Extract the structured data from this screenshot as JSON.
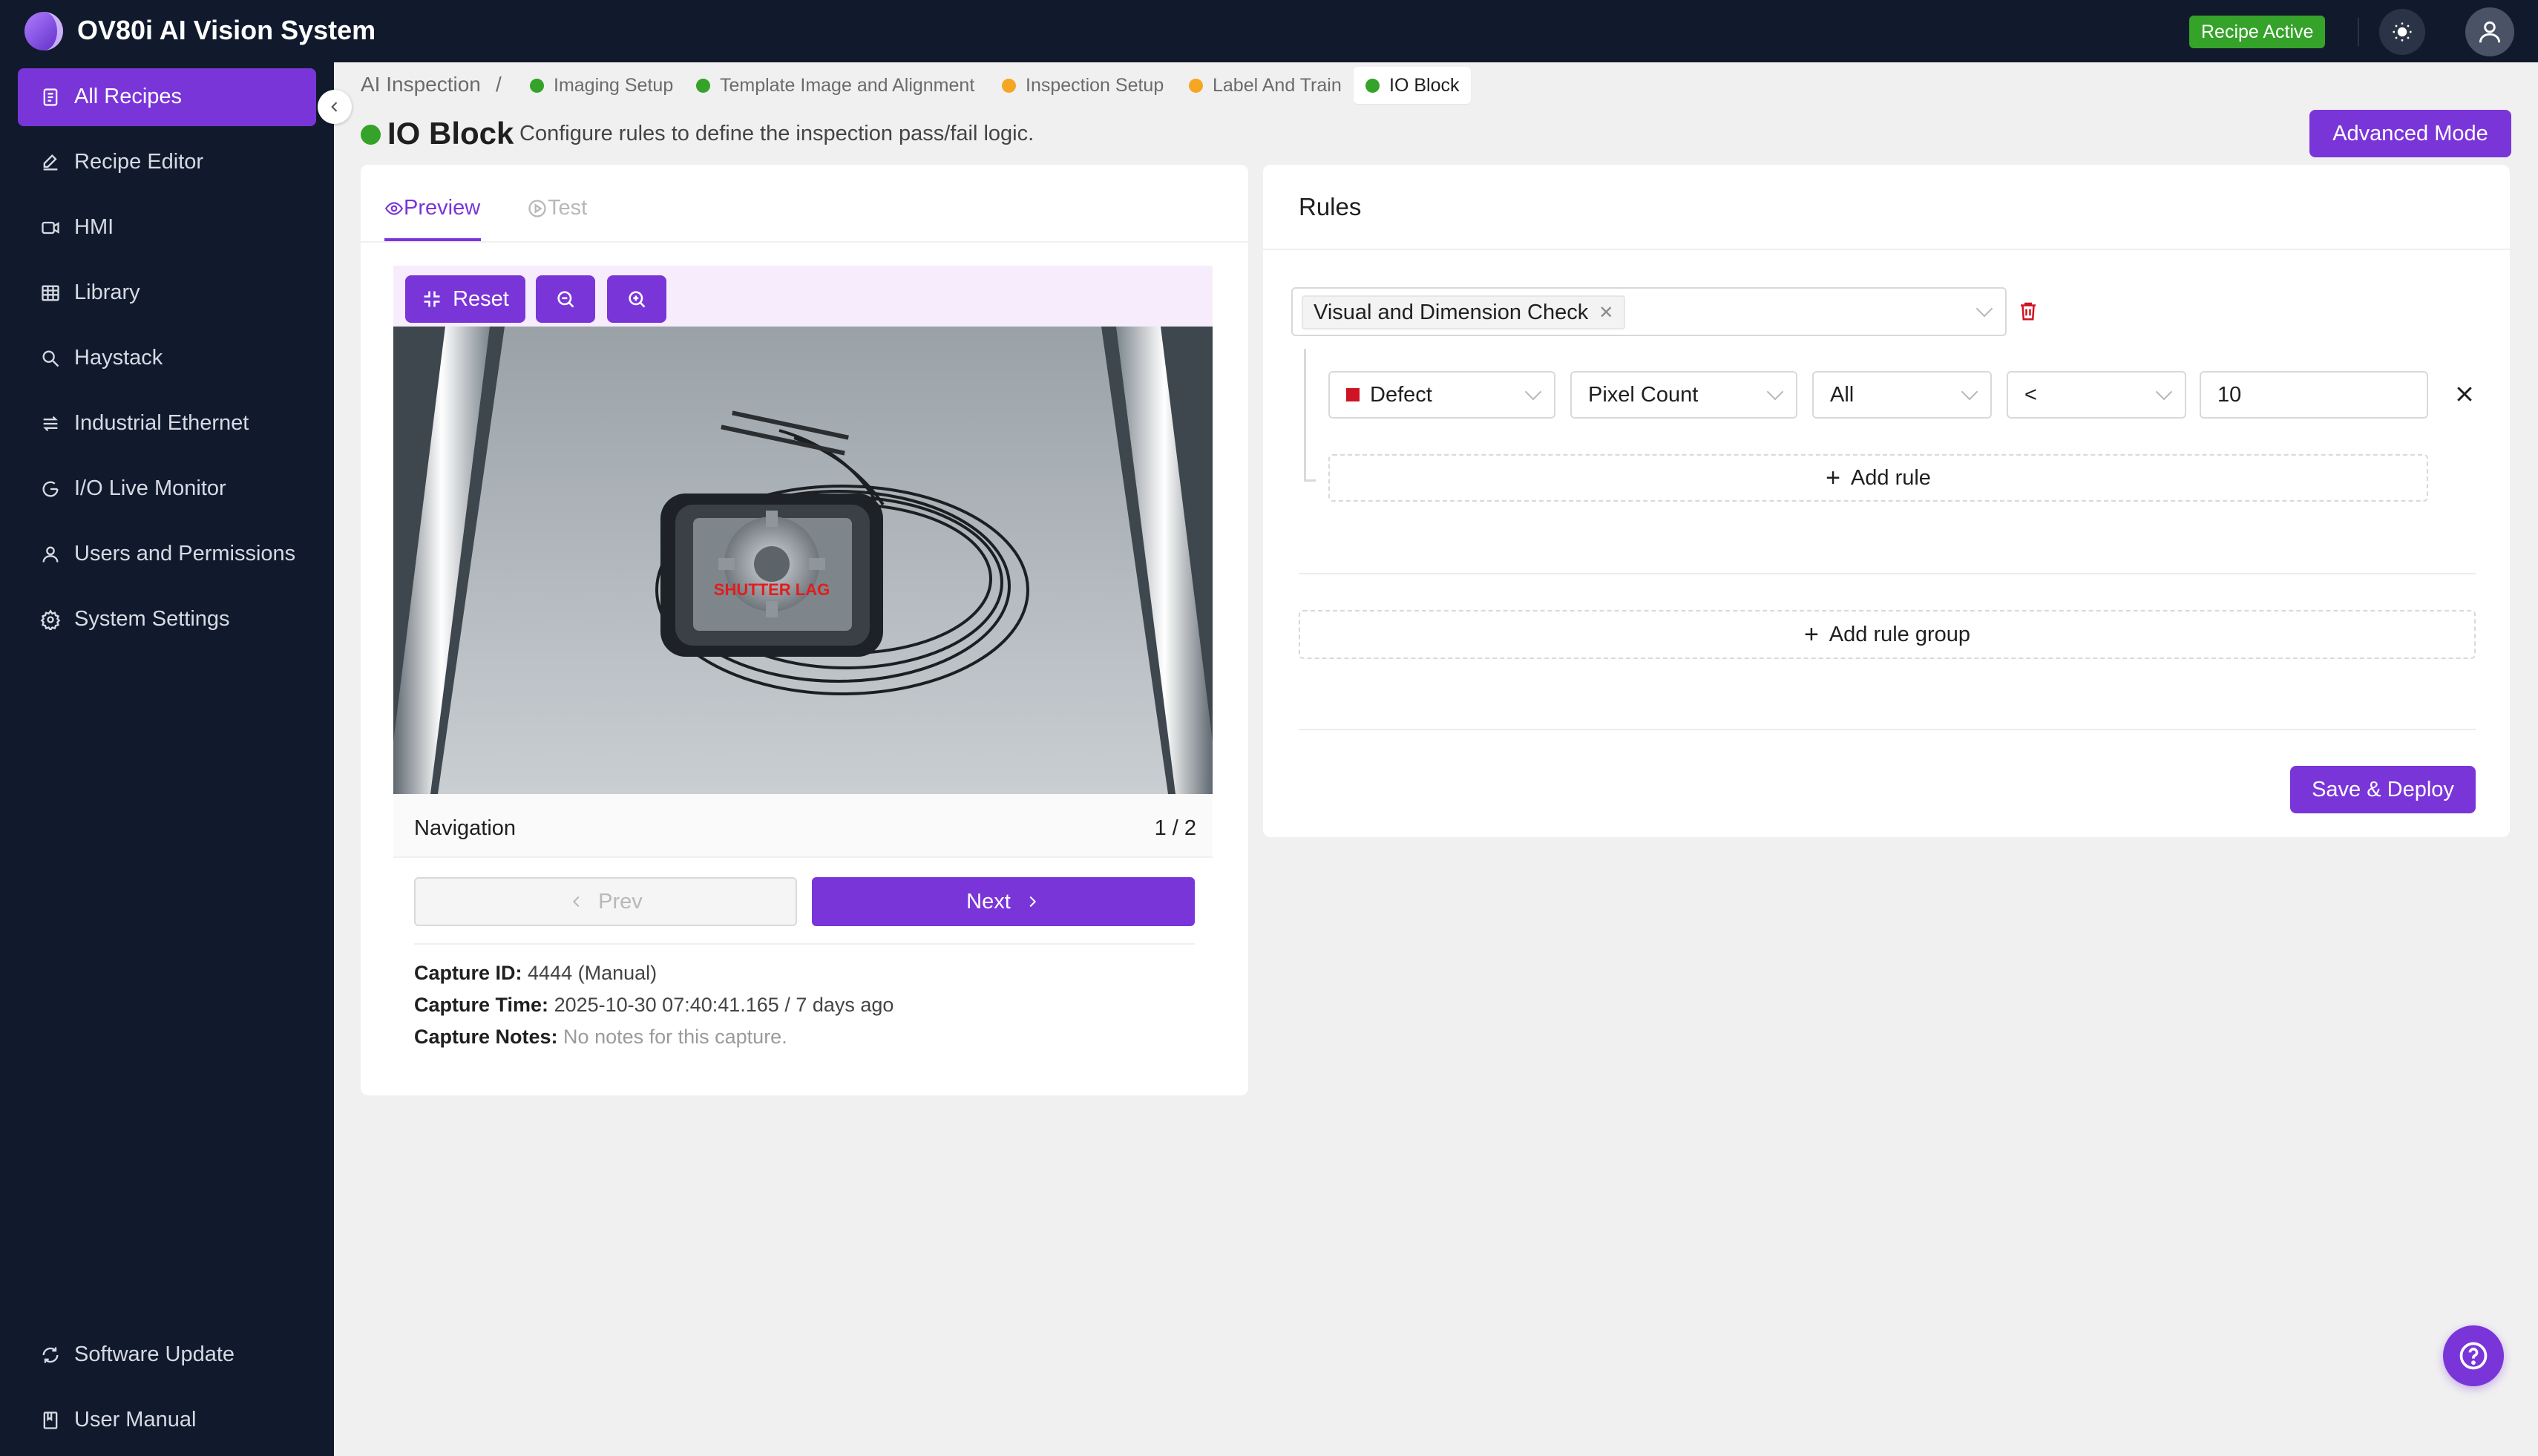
{
  "app": {
    "title": "OV80i AI Vision System",
    "status_badge": "Recipe Active"
  },
  "colors": {
    "accent": "#7a35d9",
    "sidebar_bg": "#111a2d",
    "success": "#35a22a",
    "warning": "#f5a623",
    "danger": "#cf1322"
  },
  "sidebar": {
    "items": [
      {
        "label": "All Recipes",
        "icon": "recipes-icon",
        "active": true
      },
      {
        "label": "Recipe Editor",
        "icon": "edit-icon"
      },
      {
        "label": "HMI",
        "icon": "hmi-icon"
      },
      {
        "label": "Library",
        "icon": "library-icon"
      },
      {
        "label": "Haystack",
        "icon": "search-icon"
      },
      {
        "label": "Industrial Ethernet",
        "icon": "ethernet-icon"
      },
      {
        "label": "I/O Live Monitor",
        "icon": "monitor-icon"
      },
      {
        "label": "Users and Permissions",
        "icon": "user-icon"
      },
      {
        "label": "System Settings",
        "icon": "gear-icon"
      }
    ],
    "footer": [
      {
        "label": "Software Update",
        "icon": "refresh-icon"
      },
      {
        "label": "User Manual",
        "icon": "book-icon"
      }
    ]
  },
  "breadcrumb": {
    "root": "AI Inspection",
    "separator": "/",
    "steps": [
      {
        "label": "Imaging Setup",
        "status": "complete"
      },
      {
        "label": "Template Image and Alignment",
        "status": "complete"
      },
      {
        "label": "Inspection Setup",
        "status": "warning"
      },
      {
        "label": "Label And Train",
        "status": "warning"
      },
      {
        "label": "IO Block",
        "status": "complete",
        "current": true
      }
    ]
  },
  "page": {
    "title": "IO Block",
    "description": "Configure rules to define the inspection pass/fail logic.",
    "advanced_button": "Advanced Mode"
  },
  "preview": {
    "tabs": [
      {
        "label": "Preview",
        "active": true
      },
      {
        "label": "Test",
        "active": false
      }
    ],
    "toolbar": {
      "reset_label": "Reset"
    },
    "image_overlay_text": "SHUTTER LAG",
    "navigation": {
      "label": "Navigation",
      "count": "1 / 2",
      "prev_label": "Prev",
      "next_label": "Next"
    },
    "capture": {
      "id_label": "Capture ID:",
      "id_value": "4444 (Manual)",
      "time_label": "Capture Time:",
      "time_value": "2025-10-30 07:40:41.165 / 7 days ago",
      "notes_label": "Capture Notes:",
      "notes_value": "No notes for this capture."
    }
  },
  "rules": {
    "title": "Rules",
    "group_selector_tag": "Visual and Dimension Check",
    "rule": {
      "class": "Defect",
      "metric": "Pixel Count",
      "scope": "All",
      "operator": "<",
      "value": "10"
    },
    "add_rule": "Add rule",
    "add_rule_group": "Add rule group",
    "save_button": "Save & Deploy"
  }
}
